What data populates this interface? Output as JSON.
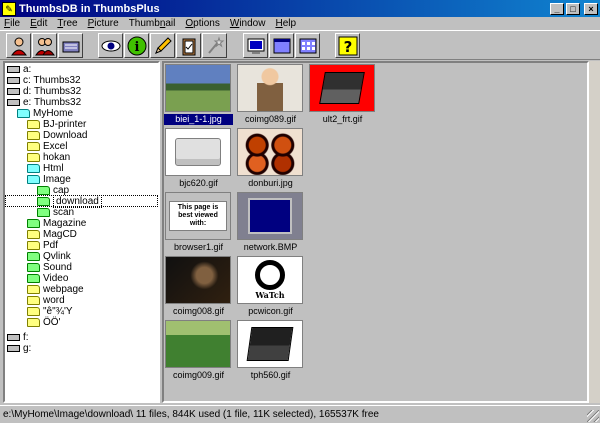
{
  "window": {
    "title": "ThumbsDB in ThumbsPlus"
  },
  "menu": [
    {
      "pre": "",
      "u": "F",
      "post": "ile"
    },
    {
      "pre": "",
      "u": "E",
      "post": "dit"
    },
    {
      "pre": "",
      "u": "T",
      "post": "ree"
    },
    {
      "pre": "",
      "u": "P",
      "post": "icture"
    },
    {
      "pre": "Thumb",
      "u": "n",
      "post": "ail"
    },
    {
      "pre": "",
      "u": "O",
      "post": "ptions"
    },
    {
      "pre": "",
      "u": "W",
      "post": "indow"
    },
    {
      "pre": "",
      "u": "H",
      "post": "elp"
    }
  ],
  "toolbar": [
    {
      "icon": "person-icon"
    },
    {
      "icon": "people-icon"
    },
    {
      "icon": "pen-tablet-icon"
    },
    {
      "icon": "eye-icon"
    },
    {
      "icon": "info-icon"
    },
    {
      "icon": "pencil-icon"
    },
    {
      "icon": "clipboard-icon"
    },
    {
      "icon": "magic-wand-icon"
    },
    {
      "icon": "monitor-icon"
    },
    {
      "icon": "window-icon"
    },
    {
      "icon": "grid-icon"
    },
    {
      "icon": "help-icon"
    }
  ],
  "tree": [
    {
      "label": "a:",
      "type": "drive",
      "level": 0
    },
    {
      "label": "c:  Thumbs32",
      "type": "drive",
      "level": 0
    },
    {
      "label": "d:  Thumbs32",
      "type": "drive",
      "level": 0
    },
    {
      "label": "e:  Thumbs32",
      "type": "drive",
      "level": 0
    },
    {
      "label": "MyHome",
      "type": "open",
      "level": 1
    },
    {
      "label": "BJ-printer",
      "type": "folder",
      "level": 2
    },
    {
      "label": "Download",
      "type": "folder",
      "level": 2
    },
    {
      "label": "Excel",
      "type": "folder",
      "level": 2
    },
    {
      "label": "hokan",
      "type": "folder",
      "level": 2
    },
    {
      "label": "Html",
      "type": "open",
      "level": 2
    },
    {
      "label": "Image",
      "type": "open",
      "level": 2
    },
    {
      "label": "cap",
      "type": "green",
      "level": 3
    },
    {
      "label": "download",
      "type": "green",
      "level": 3,
      "selected": true
    },
    {
      "label": "scan",
      "type": "green",
      "level": 3
    },
    {
      "label": "Magazine",
      "type": "green",
      "level": 2
    },
    {
      "label": "MagCD",
      "type": "folder",
      "level": 2
    },
    {
      "label": "Pdf",
      "type": "folder",
      "level": 2
    },
    {
      "label": "Qvlink",
      "type": "green",
      "level": 2
    },
    {
      "label": "Sound",
      "type": "green",
      "level": 2
    },
    {
      "label": "Video",
      "type": "green",
      "level": 2
    },
    {
      "label": "webpage",
      "type": "folder",
      "level": 2
    },
    {
      "label": "word",
      "type": "folder",
      "level": 2
    },
    {
      "label": "\"ê\"¾'Y",
      "type": "folder",
      "level": 2
    },
    {
      "label": "ÖÖ'",
      "type": "folder",
      "level": 2
    },
    {
      "label": "f:",
      "type": "drive",
      "level": 0,
      "gap": true
    },
    {
      "label": "g:",
      "type": "drive",
      "level": 0
    }
  ],
  "thumbnails": [
    {
      "name": "biei_1-1.jpg",
      "art": "landscape",
      "selected": true
    },
    {
      "name": "coimg089.gif",
      "art": "portrait"
    },
    {
      "name": "ult2_frt.gif",
      "art": "laptop-red"
    },
    {
      "name": "bjc620.gif",
      "art": "printer"
    },
    {
      "name": "donburi.jpg",
      "art": "bowls"
    },
    {
      "name": "browser1.gif",
      "art": "browser",
      "text": "This page is best viewed with:"
    },
    {
      "name": "network.BMP",
      "art": "network"
    },
    {
      "name": "coimg008.gif",
      "art": "dark"
    },
    {
      "name": "pcwicon.gif",
      "art": "pcw",
      "text": "WaTch"
    },
    {
      "name": "coimg009.gif",
      "art": "outdoor"
    },
    {
      "name": "tph560.gif",
      "art": "laptop"
    }
  ],
  "status": {
    "text": "e:\\MyHome\\Image\\download\\ 11 files, 844K used (1 file, 11K selected), 165537K free"
  }
}
